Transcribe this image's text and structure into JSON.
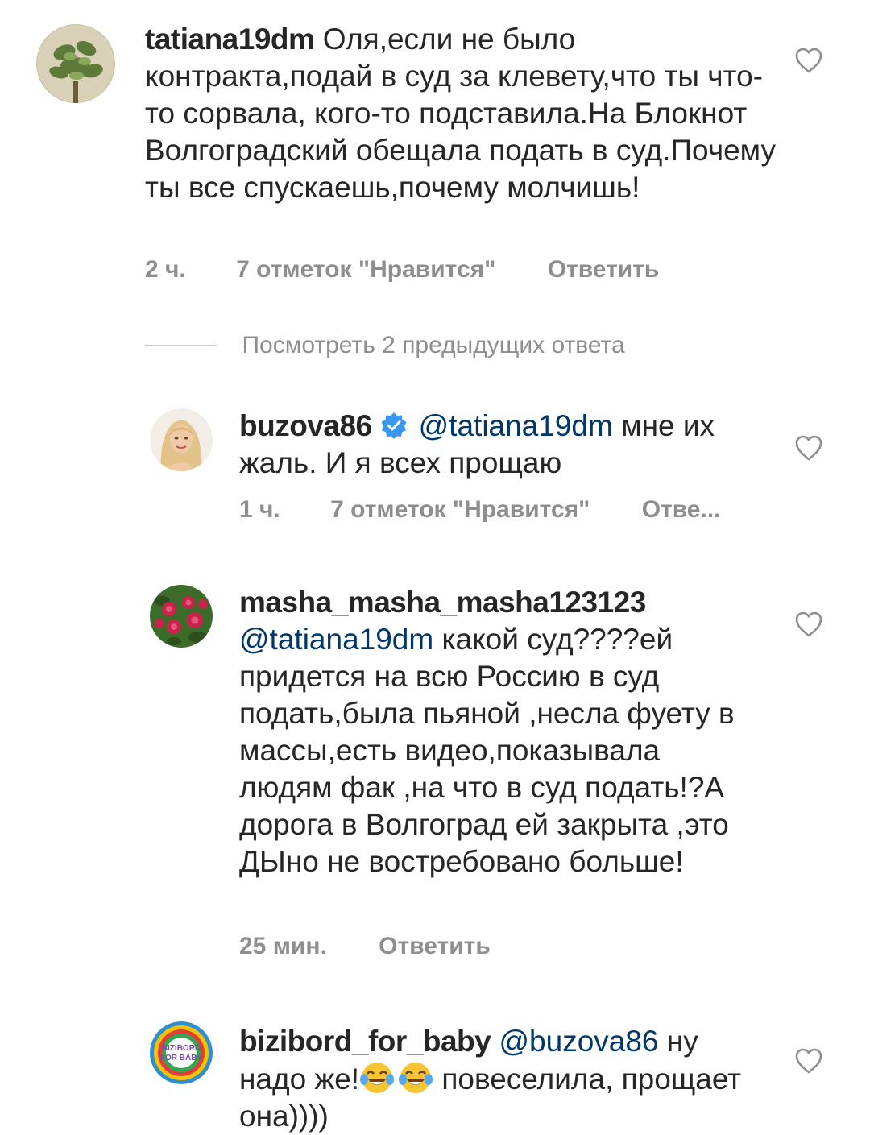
{
  "comments": [
    {
      "username": "tatiana19dm",
      "mention": "",
      "text": "Оля,если не было контракта,подай в суд за клевету,что ты что-то сорвала, кого-то подставила.На Блокнот Волгоградский обещала подать в суд.Почему ты все спускаешь,почему молчишь!",
      "time": "2 ч.",
      "likes": "7 отметок \"Нравится\"",
      "reply": "Ответить"
    },
    {
      "username": "buzova86",
      "mention": "@tatiana19dm",
      "text": "мне их жаль. И я всех прощаю",
      "time": "1 ч.",
      "likes": "7 отметок \"Нравится\"",
      "reply": "Отве..."
    },
    {
      "username": "masha_masha_masha123123",
      "mention": "@tatiana19dm",
      "text": "какой суд????ей придется на  всю Россию в суд подать,была пьяной ,несла фуету в массы,есть видео,показывала людям фак ,на что в суд подать!?А дорога в Волгоград ей закрыта ,это ДЫно не востребовано больше!",
      "time": "25 мин.",
      "reply": "Ответить"
    },
    {
      "username": "bizibord_for_baby",
      "mention": "@buzova86",
      "text_a": "ну надо же!",
      "text_b": "повеселила, прощает она))))",
      "avatar_text": "BIZIBORD FOR BABY"
    }
  ],
  "view_replies": "Посмотреть 2 предыдущих ответа",
  "colors": {
    "text": "#262626",
    "meta": "#8e8e8e",
    "mention": "#00376b",
    "verified": "#3897f0"
  },
  "icons": {
    "like": "heart-outline-icon",
    "verified": "verified-badge-icon",
    "emoji": "tears-of-joy-emoji"
  }
}
